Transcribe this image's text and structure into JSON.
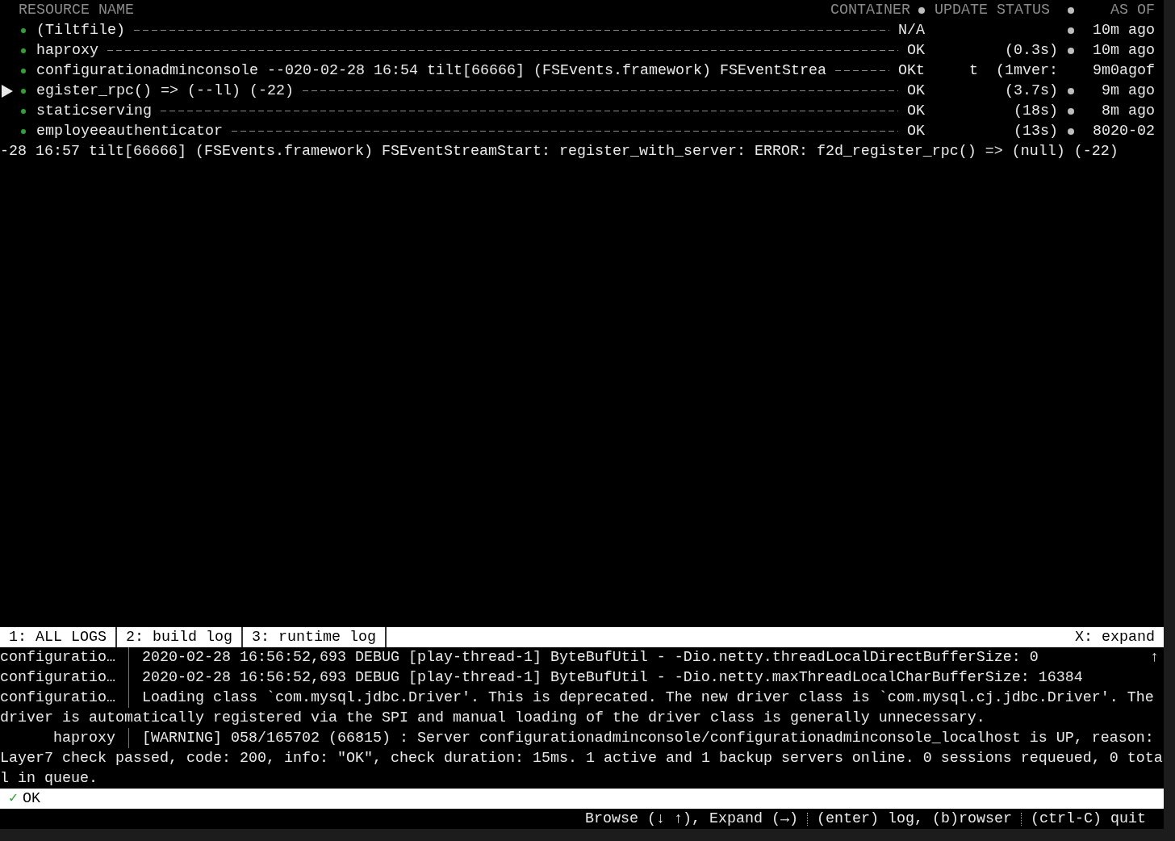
{
  "resource_header": {
    "name": "RESOURCE NAME",
    "container": "CONTAINER",
    "update_status": "UPDATE STATUS",
    "as_of": "AS OF"
  },
  "resources": [
    {
      "selected": false,
      "name": "(Tiltfile)",
      "status": "N/A",
      "dot": true,
      "time": "10m ago"
    },
    {
      "selected": false,
      "name": "haproxy",
      "status": "OK",
      "duration": "(0.3s)",
      "dot": true,
      "time": "10m ago"
    },
    {
      "selected": false,
      "name": "configurationadminconsole",
      "overlay": "--020-02-28 16:54 tilt[66666] (FSEvents.framework) FSEventStrea",
      "status": "OKt",
      "duration": "t  (1mver:",
      "dot": false,
      "time": "9m0agof"
    },
    {
      "selected": true,
      "name": "egister_rpc() => (--ll) (-22)",
      "status": "OK",
      "duration": "(3.7s)",
      "dot": true,
      "time": "9m ago"
    },
    {
      "selected": false,
      "name": "staticserving",
      "status": "OK",
      "duration": "(18s)",
      "dot": true,
      "time": "8m ago"
    },
    {
      "selected": false,
      "name": "employeeauthenticator",
      "status": "OK",
      "duration": "(13s)",
      "dot": true,
      "time": "8020-02"
    }
  ],
  "error_line": "-28 16:57 tilt[66666] (FSEvents.framework) FSEventStreamStart: register_with_server: ERROR: f2d_register_rpc() => (null) (-22)",
  "log_tabs": [
    "1: ALL LOGS",
    "2: build log",
    "3: runtime log"
  ],
  "expand_hint": "X: expand",
  "scroll_marker": "↑",
  "logs": [
    {
      "source": "configuratio…",
      "message": "2020-02-28 16:56:52,693 DEBUG [play-thread-1] ByteBufUtil - -Dio.netty.threadLocalDirectBufferSize: 0"
    },
    {
      "source": "configuratio…",
      "message": "2020-02-28 16:56:52,693 DEBUG [play-thread-1] ByteBufUtil - -Dio.netty.maxThreadLocalCharBufferSize: 16384"
    },
    {
      "source": "configuratio…",
      "message": "Loading class `com.mysql.jdbc.Driver'. This is deprecated. The new driver class is `com.mysql.cj.jdbc.Driver'. The driver is automatically registered via the SPI and manual loading of the driver class is generally unnecessary."
    },
    {
      "source": "haproxy",
      "message": "[WARNING] 058/165702 (66815) : Server configurationadminconsole/configurationadminconsole_localhost is UP, reason: Layer7 check passed, code: 200, info: \"OK\", check duration: 15ms. 1 active and 1 backup servers online. 0 sessions requeued, 0 total in queue."
    }
  ],
  "status": {
    "icon": "✓",
    "text": "OK"
  },
  "key_hints": [
    "Browse (↓ ↑), Expand (→)",
    "(enter) log, (b)rowser",
    "(ctrl-C) quit"
  ]
}
